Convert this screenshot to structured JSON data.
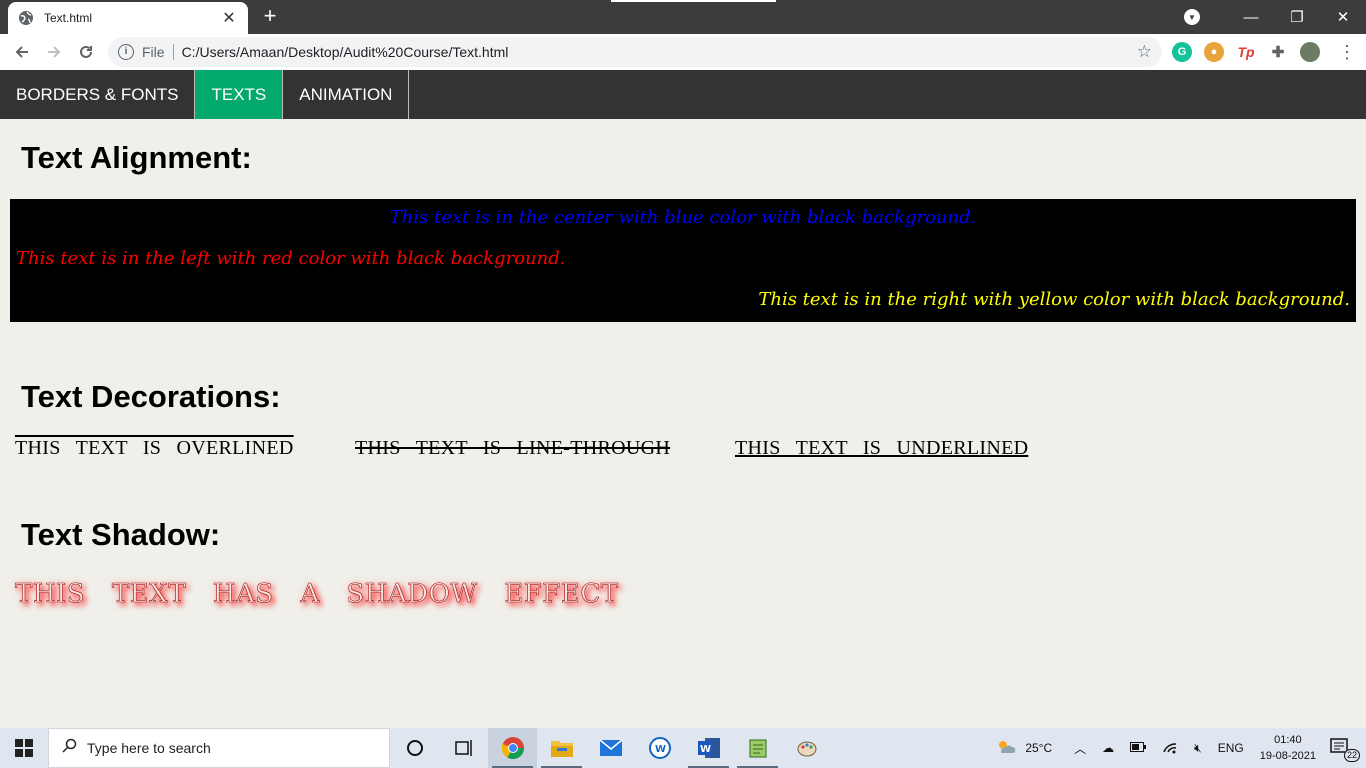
{
  "browser": {
    "tab_title": "Text.html",
    "address_prefix": "File",
    "url": "C:/Users/Amaan/Desktop/Audit%20Course/Text.html"
  },
  "nav": {
    "items": [
      {
        "label": "BORDERS & FONTS",
        "active": false
      },
      {
        "label": "TEXTS",
        "active": true
      },
      {
        "label": "ANIMATION",
        "active": false
      }
    ]
  },
  "alignment": {
    "heading": "Text Alignment:",
    "center_text": "This text is in the center with blue color with black background.",
    "left_text": "This text is in the left with red color with black background.",
    "right_text": "This text is in the right with yellow color with black background."
  },
  "decorations": {
    "heading": "Text Decorations:",
    "overline": "THIS TEXT IS OVERLINED",
    "linethrough": "THIS TEXT IS LINE-THROUGH",
    "underline": "THIS TEXT IS UNDERLINED"
  },
  "shadow": {
    "heading": "Text Shadow:",
    "text": "THIS TEXT HAS A SHADOW EFFECT"
  },
  "taskbar": {
    "search_placeholder": "Type here to search",
    "weather": "25°C",
    "language": "ENG",
    "time": "01:40",
    "date": "19-08-2021",
    "notifications": "22"
  },
  "colors": {
    "nav_bg": "#333333",
    "nav_active": "#04aa6d",
    "page_bg": "#f0efe9",
    "align_bg": "#000000",
    "center_color": "#0000ff",
    "left_color": "#ff0000",
    "right_color": "#ffff00"
  }
}
